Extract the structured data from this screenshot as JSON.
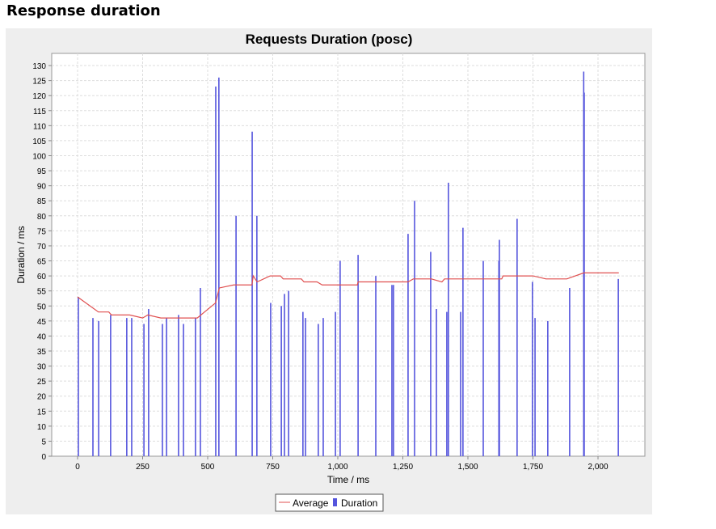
{
  "page_heading": "Response duration",
  "chart_data": {
    "type": "bar",
    "title": "Requests Duration (posc)",
    "xlabel": "Time / ms",
    "ylabel": "Duration / ms",
    "xlim": [
      -100,
      2180
    ],
    "ylim": [
      0,
      132
    ],
    "xticks": [
      0,
      250,
      500,
      750,
      1000,
      1250,
      1500,
      1750,
      2000
    ],
    "xtick_labels": [
      "0",
      "250",
      "500",
      "750",
      "1,000",
      "1,250",
      "1,500",
      "1,750",
      "2,000"
    ],
    "yticks": [
      0,
      5,
      10,
      15,
      20,
      25,
      30,
      35,
      40,
      45,
      50,
      55,
      60,
      65,
      70,
      75,
      80,
      85,
      90,
      95,
      100,
      105,
      110,
      115,
      120,
      125,
      130
    ],
    "grid": true,
    "legend": {
      "placement": "bottom-center",
      "entries": [
        "Average",
        "Duration"
      ]
    },
    "colors": {
      "average": "#e05050",
      "duration": "#5555dd"
    },
    "series": [
      {
        "name": "Duration",
        "type": "bar",
        "points": [
          [
            3,
            53
          ],
          [
            59,
            46
          ],
          [
            81,
            45
          ],
          [
            127,
            47
          ],
          [
            189,
            46
          ],
          [
            208,
            46
          ],
          [
            255,
            44
          ],
          [
            273,
            49
          ],
          [
            326,
            44
          ],
          [
            342,
            46
          ],
          [
            388,
            47
          ],
          [
            407,
            44
          ],
          [
            453,
            46
          ],
          [
            472,
            56
          ],
          [
            531,
            123
          ],
          [
            543,
            126
          ],
          [
            609,
            80
          ],
          [
            671,
            108
          ],
          [
            689,
            80
          ],
          [
            742,
            51
          ],
          [
            783,
            50
          ],
          [
            795,
            54
          ],
          [
            811,
            55
          ],
          [
            866,
            48
          ],
          [
            876,
            46
          ],
          [
            925,
            44
          ],
          [
            944,
            46
          ],
          [
            991,
            48
          ],
          [
            1009,
            65
          ],
          [
            1078,
            67
          ],
          [
            1146,
            60
          ],
          [
            1208,
            57
          ],
          [
            1214,
            57
          ],
          [
            1270,
            74
          ],
          [
            1295,
            85
          ],
          [
            1357,
            68
          ],
          [
            1379,
            49
          ],
          [
            1419,
            48
          ],
          [
            1425,
            91
          ],
          [
            1472,
            48
          ],
          [
            1481,
            76
          ],
          [
            1559,
            65
          ],
          [
            1619,
            65
          ],
          [
            1621,
            72
          ],
          [
            1689,
            79
          ],
          [
            1748,
            58
          ],
          [
            1758,
            46
          ],
          [
            1807,
            45
          ],
          [
            1891,
            56
          ],
          [
            1945,
            128
          ],
          [
            1947,
            121
          ],
          [
            2078,
            59
          ]
        ]
      },
      {
        "name": "Average",
        "type": "line",
        "points": [
          [
            0,
            53
          ],
          [
            80,
            48
          ],
          [
            120,
            48
          ],
          [
            130,
            47
          ],
          [
            200,
            47
          ],
          [
            250,
            46
          ],
          [
            270,
            47
          ],
          [
            320,
            46
          ],
          [
            460,
            46
          ],
          [
            530,
            51
          ],
          [
            545,
            56
          ],
          [
            600,
            57
          ],
          [
            670,
            57
          ],
          [
            675,
            60
          ],
          [
            690,
            58
          ],
          [
            740,
            60
          ],
          [
            780,
            60
          ],
          [
            790,
            59
          ],
          [
            860,
            59
          ],
          [
            870,
            58
          ],
          [
            920,
            58
          ],
          [
            940,
            57
          ],
          [
            1075,
            57
          ],
          [
            1078,
            58
          ],
          [
            1270,
            58
          ],
          [
            1290,
            59
          ],
          [
            1360,
            59
          ],
          [
            1400,
            58
          ],
          [
            1410,
            59
          ],
          [
            1630,
            59
          ],
          [
            1635,
            60
          ],
          [
            1750,
            60
          ],
          [
            1800,
            59
          ],
          [
            1880,
            59
          ],
          [
            1945,
            61
          ],
          [
            2080,
            61
          ]
        ]
      }
    ]
  }
}
